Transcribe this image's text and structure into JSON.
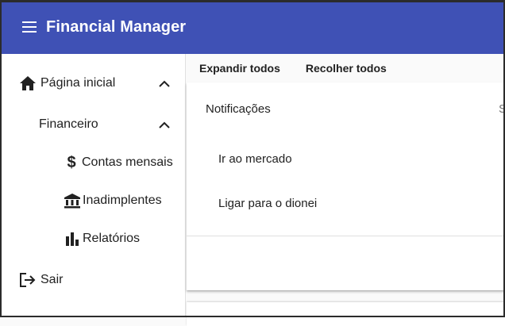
{
  "app": {
    "title": "Financial Manager"
  },
  "sidebar": {
    "items": [
      {
        "label": "Página inicial"
      },
      {
        "label": "Financeiro"
      },
      {
        "label": "Contas mensais"
      },
      {
        "label": "Inadimplentes"
      },
      {
        "label": "Relatórios"
      },
      {
        "label": "Sair"
      }
    ]
  },
  "actions": {
    "expand_all": "Expandir todos",
    "collapse_all": "Recolher todos"
  },
  "panel": {
    "title": "Notificações",
    "description": "S",
    "tasks": [
      "Ir ao mercado",
      "Ligar para o dionei"
    ]
  },
  "colors": {
    "toolbar": "#3f51b5",
    "text": "#212121"
  }
}
